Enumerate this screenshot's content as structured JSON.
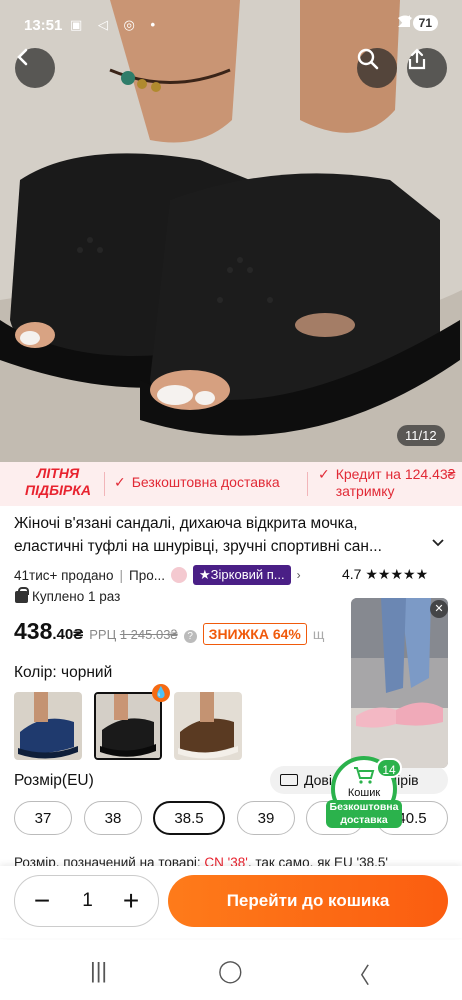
{
  "status_bar": {
    "time": "13:51",
    "icons": "▣ ◁ ◎ •",
    "signal": "📶",
    "battery": "71"
  },
  "gallery": {
    "counter": "11/12",
    "back_icon": "chevron-left-icon",
    "search_icon": "search-icon",
    "share_icon": "share-icon"
  },
  "promo": {
    "badge": "ЛІТНЯ ПІДБІРКА",
    "free_shipping": "Безкоштовна доставка",
    "credit_line1": "Кредит на 124.43₴",
    "credit_line2": "затримку"
  },
  "product": {
    "title": "Жіночі в'язані сандалі, дихаюча відкрита мочка, еластичні туфлі на шнурівці, зручні спортивні сан...",
    "sold": "41тис+ продано",
    "brand_prefix": "Про...",
    "star_store": "★Зірковий п...",
    "rating": "4.7",
    "rating_stars": "★★★★★",
    "bought": "Куплено 1 раз"
  },
  "price": {
    "main": "438",
    "cents": ".40₴",
    "rrp_label": "РРЦ",
    "rrp_value": "1 245.03₴",
    "discount": "ЗНИЖКА 64%",
    "cut": "щ"
  },
  "color": {
    "label": "Колір: чорний",
    "badge": "💧",
    "options": [
      "синій",
      "чорний",
      "коричневий"
    ]
  },
  "size": {
    "label": "Розмір(EU)",
    "guide": "Довідник розмірів",
    "options": [
      "37",
      "38",
      "38.5",
      "39",
      "40",
      "40.5"
    ],
    "selected": "38.5"
  },
  "note": {
    "prefix": "Розмір, позначений на товарі: ",
    "highlight": "CN '38'",
    "suffix": ", так само, як EU '38.5'"
  },
  "floating": {
    "close": "✕",
    "cart_label": "Кошик",
    "cart_count": "14",
    "free_ship": "Безкоштовна доставка"
  },
  "bottom": {
    "quantity": "1",
    "minus": "−",
    "plus": "+",
    "add_to_cart": "Перейти до кошика"
  },
  "nav": {
    "recent": "|||",
    "home": "◯",
    "back": "〈"
  },
  "colors": {
    "accent_orange": "#fb5d10",
    "promo_red": "#e12a36",
    "store_purple": "#4a1f86",
    "cart_green": "#2bb24c"
  }
}
